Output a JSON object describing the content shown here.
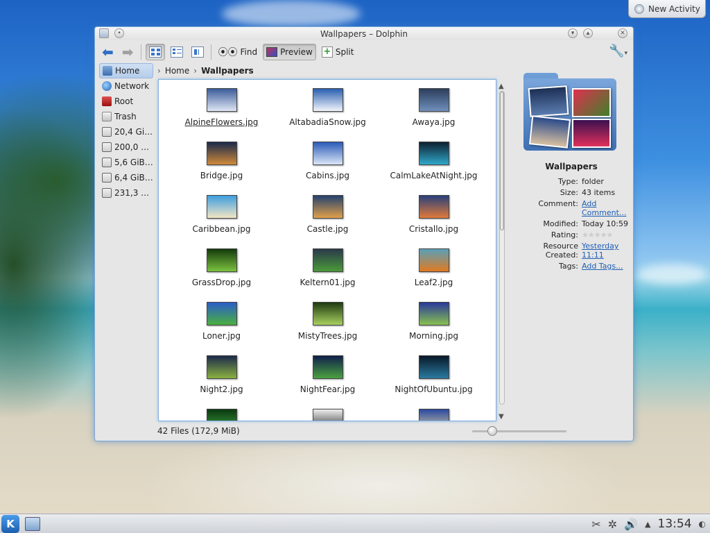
{
  "desktop": {
    "new_activity_label": "New Activity"
  },
  "window": {
    "title": "Wallpapers – Dolphin"
  },
  "toolbar": {
    "find_label": "Find",
    "preview_label": "Preview",
    "split_label": "Split"
  },
  "places": [
    {
      "label": "Home",
      "icon": "home-icon",
      "selected": true
    },
    {
      "label": "Network",
      "icon": "network-icon"
    },
    {
      "label": "Root",
      "icon": "root-folder-icon"
    },
    {
      "label": "Trash",
      "icon": "trash-icon"
    },
    {
      "label": "20,4 Gi…",
      "icon": "drive-icon"
    },
    {
      "label": "200,0 …",
      "icon": "drive-icon"
    },
    {
      "label": "5,6 GiB…",
      "icon": "drive-icon"
    },
    {
      "label": "6,4 GiB…",
      "icon": "drive-icon"
    },
    {
      "label": "231,3 …",
      "icon": "drive-icon"
    }
  ],
  "breadcrumb": {
    "home": "Home",
    "current": "Wallpapers"
  },
  "files": [
    {
      "name": "AlpineFlowers.jpg",
      "colors": [
        "#3b5c9a",
        "#dfe6f4"
      ]
    },
    {
      "name": "AltabadiaSnow.jpg",
      "colors": [
        "#2a5fb0",
        "#f2f5fb"
      ]
    },
    {
      "name": "Awaya.jpg",
      "colors": [
        "#2c3e5c",
        "#6f8fbc"
      ]
    },
    {
      "name": "Bridge.jpg",
      "colors": [
        "#1a2a4a",
        "#d08a3a"
      ]
    },
    {
      "name": "Cabins.jpg",
      "colors": [
        "#2a5ab8",
        "#dbe6f7"
      ]
    },
    {
      "name": "CalmLakeAtNight.jpg",
      "colors": [
        "#0d2030",
        "#2fa7c8"
      ]
    },
    {
      "name": "Caribbean.jpg",
      "colors": [
        "#3e9ee0",
        "#f2e6c4"
      ]
    },
    {
      "name": "Castle.jpg",
      "colors": [
        "#24426e",
        "#e0a04a"
      ]
    },
    {
      "name": "Cristallo.jpg",
      "colors": [
        "#28407a",
        "#e07a3a"
      ]
    },
    {
      "name": "GrassDrop.jpg",
      "colors": [
        "#143a0c",
        "#7cc23e"
      ]
    },
    {
      "name": "Keltern01.jpg",
      "colors": [
        "#2a3a4a",
        "#4a9a3a"
      ]
    },
    {
      "name": "Leaf2.jpg",
      "colors": [
        "#5aa0b8",
        "#e07a20"
      ]
    },
    {
      "name": "Loner.jpg",
      "colors": [
        "#2a5ec8",
        "#4ab040"
      ]
    },
    {
      "name": "MistyTrees.jpg",
      "colors": [
        "#1e3a10",
        "#a8d060"
      ]
    },
    {
      "name": "Morning.jpg",
      "colors": [
        "#2a3a9a",
        "#88c050"
      ]
    },
    {
      "name": "Night2.jpg",
      "colors": [
        "#1c2a4a",
        "#8ab040"
      ]
    },
    {
      "name": "NightFear.jpg",
      "colors": [
        "#10204a",
        "#4aa040"
      ]
    },
    {
      "name": "NightOfUbuntu.jpg",
      "colors": [
        "#081828",
        "#2a7aa0"
      ]
    },
    {
      "name": "",
      "colors": [
        "#0a3a10",
        "#40a040"
      ]
    },
    {
      "name": "",
      "colors": [
        "#eeeeee",
        "#222222"
      ]
    },
    {
      "name": "",
      "colors": [
        "#2a4aa0",
        "#e0d0a0"
      ]
    }
  ],
  "status": {
    "summary": "42 Files (172,9 MiB)",
    "zoom_level": 0.18
  },
  "info": {
    "title": "Wallpapers",
    "type_key": "Type:",
    "type_val": "folder",
    "size_key": "Size:",
    "size_val": "43 items",
    "comment_key": "Comment:",
    "comment_val": "Add Comment...",
    "modified_key": "Modified:",
    "modified_val": "Today 10:59",
    "rating_key": "Rating:",
    "rating_val": 0,
    "created_key": "Resource Created:",
    "created_val": "Yesterday 11:11",
    "tags_key": "Tags:",
    "tags_val": "Add Tags..."
  },
  "taskbar": {
    "clock": "13:54"
  },
  "colors": {
    "accent": "#1f5fb4",
    "selection": "#b5cdea"
  }
}
